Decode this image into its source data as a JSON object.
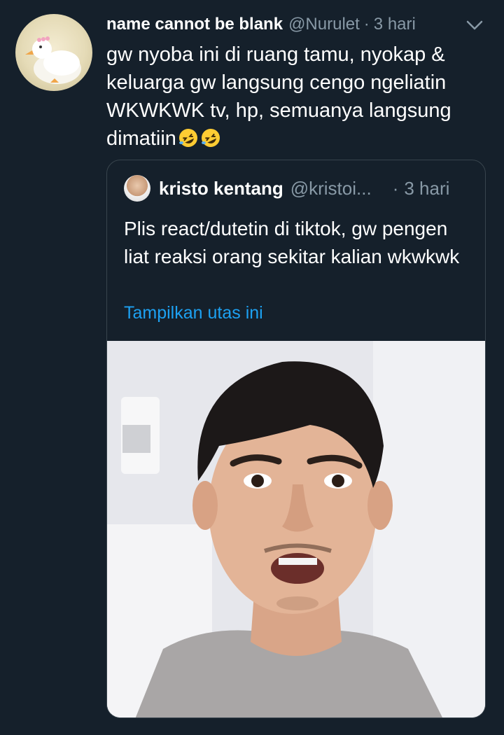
{
  "tweet": {
    "author": {
      "display_name": "name cannot be blank",
      "handle": "@Nurulet",
      "avatar": "duck-avatar"
    },
    "separator": "·",
    "time": "3 hari",
    "menu_icon": "chevron-down-icon",
    "text": "gw nyoba ini di ruang tamu, nyokap & keluarga gw langsung cengo ngeliatin WKWKWK tv, hp, semuanya langsung dimatiin",
    "emojis": [
      "rolling-on-floor-laughing-emoji",
      "rolling-on-floor-laughing-emoji"
    ]
  },
  "quoted": {
    "author": {
      "display_name": "kristo kentang",
      "handle": "@kristoi...",
      "avatar": "person-avatar"
    },
    "separator": "·",
    "time": "3 hari",
    "text": "Plis react/dutetin di tiktok, gw pengen liat reaksi orang sekitar kalian wkwkwk",
    "show_thread": "Tampilkan utas ini",
    "media": "video-thumbnail-man-speaking"
  },
  "colors": {
    "background": "#15202b",
    "secondary_text": "#8899a6",
    "link": "#1da1f2",
    "border": "#38444d"
  }
}
